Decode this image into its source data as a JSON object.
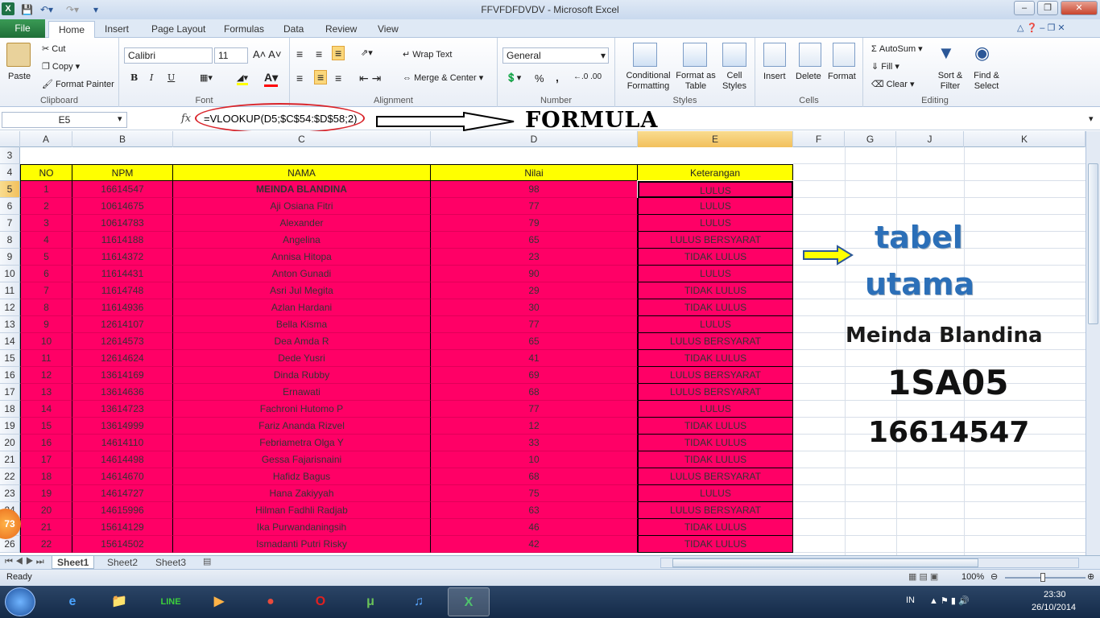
{
  "window": {
    "title": "FFVFDFDVDV  -  Microsoft Excel",
    "buttons": [
      "minimize",
      "restore",
      "close"
    ]
  },
  "tabs": [
    "File",
    "Home",
    "Insert",
    "Page Layout",
    "Formulas",
    "Data",
    "Review",
    "View"
  ],
  "ribbon": {
    "clipboard": {
      "label": "Clipboard",
      "paste": "Paste",
      "cut": "Cut",
      "copy": "Copy",
      "format_painter": "Format Painter"
    },
    "font": {
      "label": "Font",
      "family": "Calibri",
      "size": "11",
      "bold": "B",
      "italic": "I",
      "underline": "U"
    },
    "alignment": {
      "label": "Alignment",
      "wrap": "Wrap Text",
      "merge": "Merge & Center"
    },
    "number": {
      "label": "Number",
      "format": "General",
      "percent": "%",
      "comma": ","
    },
    "styles": {
      "label": "Styles",
      "conditional": "Conditional Formatting",
      "format_table": "Format as Table",
      "cell_styles": "Cell Styles"
    },
    "cells": {
      "label": "Cells",
      "insert": "Insert",
      "delete": "Delete",
      "format": "Format"
    },
    "editing": {
      "label": "Editing",
      "autosum": "AutoSum",
      "fill": "Fill",
      "clear": "Clear",
      "sort": "Sort & Filter",
      "find": "Find & Select"
    }
  },
  "formula_bar": {
    "name_box": "E5",
    "fx": "fx",
    "formula": "=VLOOKUP(D5;$C$54:$D$58;2)"
  },
  "annotation": {
    "formula_label": "FORMULA"
  },
  "columns": [
    "A",
    "B",
    "C",
    "D",
    "E",
    "F",
    "G",
    "J",
    "K"
  ],
  "header_row": {
    "row": "4",
    "no": "NO",
    "npm": "NPM",
    "nama": "NAMA",
    "nilai": "Nilai",
    "keterangan": "Keterangan"
  },
  "empty_row": "3",
  "rows": [
    {
      "r": "5",
      "no": "1",
      "npm": "16614547",
      "nama": "MEINDA BLANDINA",
      "nilai": "98",
      "ket": "LULUS"
    },
    {
      "r": "6",
      "no": "2",
      "npm": "10614675",
      "nama": "Aji Osiana Fitri",
      "nilai": "77",
      "ket": "LULUS"
    },
    {
      "r": "7",
      "no": "3",
      "npm": "10614783",
      "nama": "Alexander",
      "nilai": "79",
      "ket": "LULUS"
    },
    {
      "r": "8",
      "no": "4",
      "npm": "11614188",
      "nama": "Angelina",
      "nilai": "65",
      "ket": "LULUS BERSYARAT"
    },
    {
      "r": "9",
      "no": "5",
      "npm": "11614372",
      "nama": "Annisa Hitopa",
      "nilai": "23",
      "ket": "TIDAK LULUS"
    },
    {
      "r": "10",
      "no": "6",
      "npm": "11614431",
      "nama": "Anton Gunadi",
      "nilai": "90",
      "ket": "LULUS"
    },
    {
      "r": "11",
      "no": "7",
      "npm": "11614748",
      "nama": "Asri Jul Megita",
      "nilai": "29",
      "ket": "TIDAK LULUS"
    },
    {
      "r": "12",
      "no": "8",
      "npm": "11614936",
      "nama": "Azlan Hardani",
      "nilai": "30",
      "ket": "TIDAK LULUS"
    },
    {
      "r": "13",
      "no": "9",
      "npm": "12614107",
      "nama": "Bella Kisma",
      "nilai": "77",
      "ket": "LULUS"
    },
    {
      "r": "14",
      "no": "10",
      "npm": "12614573",
      "nama": "Dea Amda R",
      "nilai": "65",
      "ket": "LULUS BERSYARAT"
    },
    {
      "r": "15",
      "no": "11",
      "npm": "12614624",
      "nama": "Dede Yusri",
      "nilai": "41",
      "ket": "TIDAK LULUS"
    },
    {
      "r": "16",
      "no": "12",
      "npm": "13614169",
      "nama": "Dinda Rubby",
      "nilai": "69",
      "ket": "LULUS BERSYARAT"
    },
    {
      "r": "17",
      "no": "13",
      "npm": "13614636",
      "nama": "Ernawati",
      "nilai": "68",
      "ket": "LULUS BERSYARAT"
    },
    {
      "r": "18",
      "no": "14",
      "npm": "13614723",
      "nama": "Fachroni Hutomo P",
      "nilai": "77",
      "ket": "LULUS"
    },
    {
      "r": "19",
      "no": "15",
      "npm": "13614999",
      "nama": "Fariz Ananda Rizvel",
      "nilai": "12",
      "ket": "TIDAK LULUS"
    },
    {
      "r": "20",
      "no": "16",
      "npm": "14614110",
      "nama": "Febriametra Olga Y",
      "nilai": "33",
      "ket": "TIDAK LULUS"
    },
    {
      "r": "21",
      "no": "17",
      "npm": "14614498",
      "nama": "Gessa Fajarisnaini",
      "nilai": "10",
      "ket": "TIDAK LULUS"
    },
    {
      "r": "22",
      "no": "18",
      "npm": "14614670",
      "nama": "Hafidz Bagus",
      "nilai": "68",
      "ket": "LULUS BERSYARAT"
    },
    {
      "r": "23",
      "no": "19",
      "npm": "14614727",
      "nama": "Hana Zakiyyah",
      "nilai": "75",
      "ket": "LULUS"
    },
    {
      "r": "24",
      "no": "20",
      "npm": "14615996",
      "nama": "Hilman Fadhli Radjab",
      "nilai": "63",
      "ket": "LULUS BERSYARAT"
    },
    {
      "r": "25",
      "no": "21",
      "npm": "15614129",
      "nama": "Ika Purwandaningsih",
      "nilai": "46",
      "ket": "TIDAK LULUS"
    },
    {
      "r": "26",
      "no": "22",
      "npm": "15614502",
      "nama": "Ismadanti Putri Risky",
      "nilai": "42",
      "ket": "TIDAK LULUS"
    }
  ],
  "side_text": {
    "tabel": "tabel",
    "utama": "utama",
    "name": "Meinda Blandina",
    "class": "1SA05",
    "npm": "16614547"
  },
  "sheets": [
    "Sheet1",
    "Sheet2",
    "Sheet3"
  ],
  "status": {
    "ready": "Ready",
    "zoom": "100%"
  },
  "taskbar": {
    "lang": "IN",
    "time": "23:30",
    "date": "26/10/2014",
    "badge": "73"
  },
  "colors": {
    "pink": "#ff0066",
    "header_yellow": "#ffff00",
    "accent": "#2b6fb8"
  }
}
